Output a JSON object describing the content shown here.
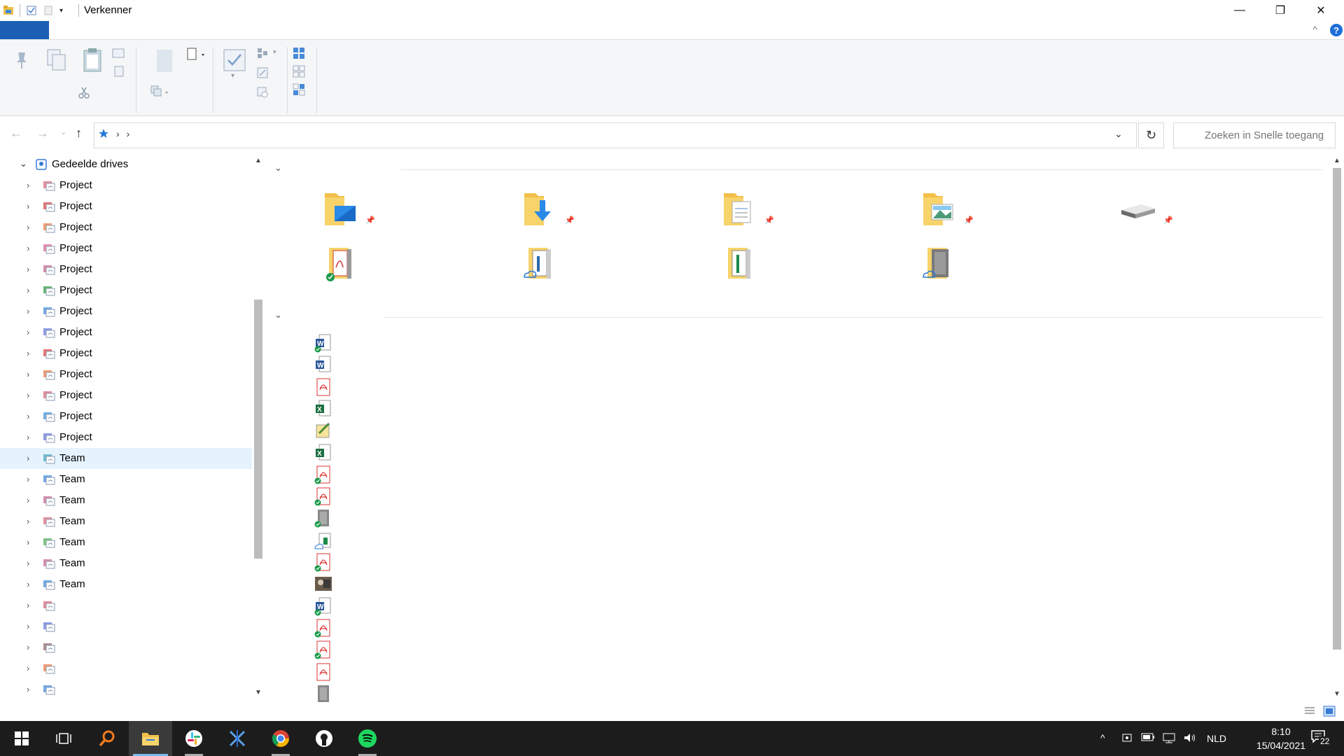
{
  "window": {
    "title": "Verkenner",
    "minimize_glyph": "—",
    "maximize_glyph": "❐",
    "close_glyph": "✕"
  },
  "ribbon": {
    "help_label": "?",
    "collapse_glyph": "^"
  },
  "address": {
    "path_sep_1": "›",
    "path_sep_2": "›",
    "dropdown_glyph": "⌄",
    "refresh_glyph": "↻"
  },
  "search": {
    "placeholder": "Zoeken in Snelle toegang"
  },
  "nav": {
    "root_label": "Gedeelde drives",
    "items": [
      {
        "label": "Project",
        "color": "#e07a8a"
      },
      {
        "label": "Project",
        "color": "#e05a5a"
      },
      {
        "label": "Project",
        "color": "#f08a5a"
      },
      {
        "label": "Project",
        "color": "#e07aa0"
      },
      {
        "label": "Project",
        "color": "#d07a9a"
      },
      {
        "label": "Project",
        "color": "#4aaa5a"
      },
      {
        "label": "Project",
        "color": "#5a9ae0"
      },
      {
        "label": "Project",
        "color": "#7a8ae0"
      },
      {
        "label": "Project",
        "color": "#e05a5a"
      },
      {
        "label": "Project",
        "color": "#f08a5a"
      },
      {
        "label": "Project",
        "color": "#e07a8a"
      },
      {
        "label": "Project",
        "color": "#5aa0e0"
      },
      {
        "label": "Project",
        "color": "#7a8ae0"
      },
      {
        "label": "Team",
        "color": "#5ab0c0"
      },
      {
        "label": "Team",
        "color": "#5a9ae0"
      },
      {
        "label": "Team",
        "color": "#d07aa0"
      },
      {
        "label": "Team",
        "color": "#e07a8a"
      },
      {
        "label": "Team",
        "color": "#6aba6a"
      },
      {
        "label": "Team",
        "color": "#d07aa0"
      },
      {
        "label": "Team",
        "color": "#5a9ae0"
      },
      {
        "label": "",
        "color": "#e07a8a"
      },
      {
        "label": "",
        "color": "#7a8ae0"
      },
      {
        "label": "",
        "color": "#a07a7a"
      },
      {
        "label": "",
        "color": "#f08a5a"
      },
      {
        "label": "",
        "color": "#5a9ae0"
      }
    ]
  },
  "taskbar": {
    "language": "NLD",
    "time": "8:10",
    "date": "15/04/2021",
    "notification_count": "22"
  }
}
